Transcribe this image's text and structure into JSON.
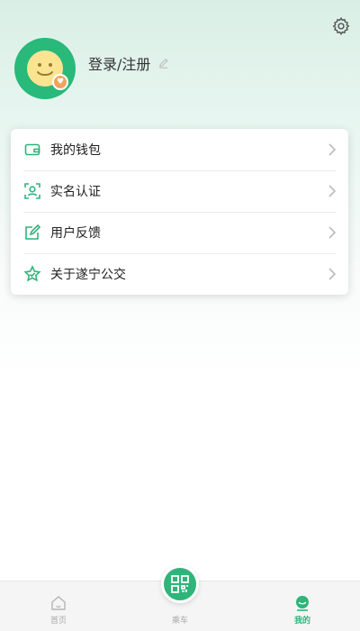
{
  "header": {
    "settings_icon": "gear-icon",
    "login_text": "登录/注册",
    "avatar_icon": "smiley-avatar-icon",
    "avatar_badge_icon": "heart-icon"
  },
  "menu": {
    "items": [
      {
        "label": "我的钱包",
        "icon": "wallet-icon"
      },
      {
        "label": "实名认证",
        "icon": "face-scan-icon"
      },
      {
        "label": "用户反馈",
        "icon": "edit-icon"
      },
      {
        "label": "关于遂宁公交",
        "icon": "star-icon"
      }
    ]
  },
  "tabbar": {
    "tabs": [
      {
        "label": "首页",
        "icon": "home-icon"
      },
      {
        "label": "乘车",
        "icon": "qr-code-icon"
      },
      {
        "label": "我的",
        "icon": "person-icon"
      }
    ],
    "active_color": "#2fb47a"
  },
  "colors": {
    "accent": "#28b97b",
    "badge": "#f1a35b"
  }
}
